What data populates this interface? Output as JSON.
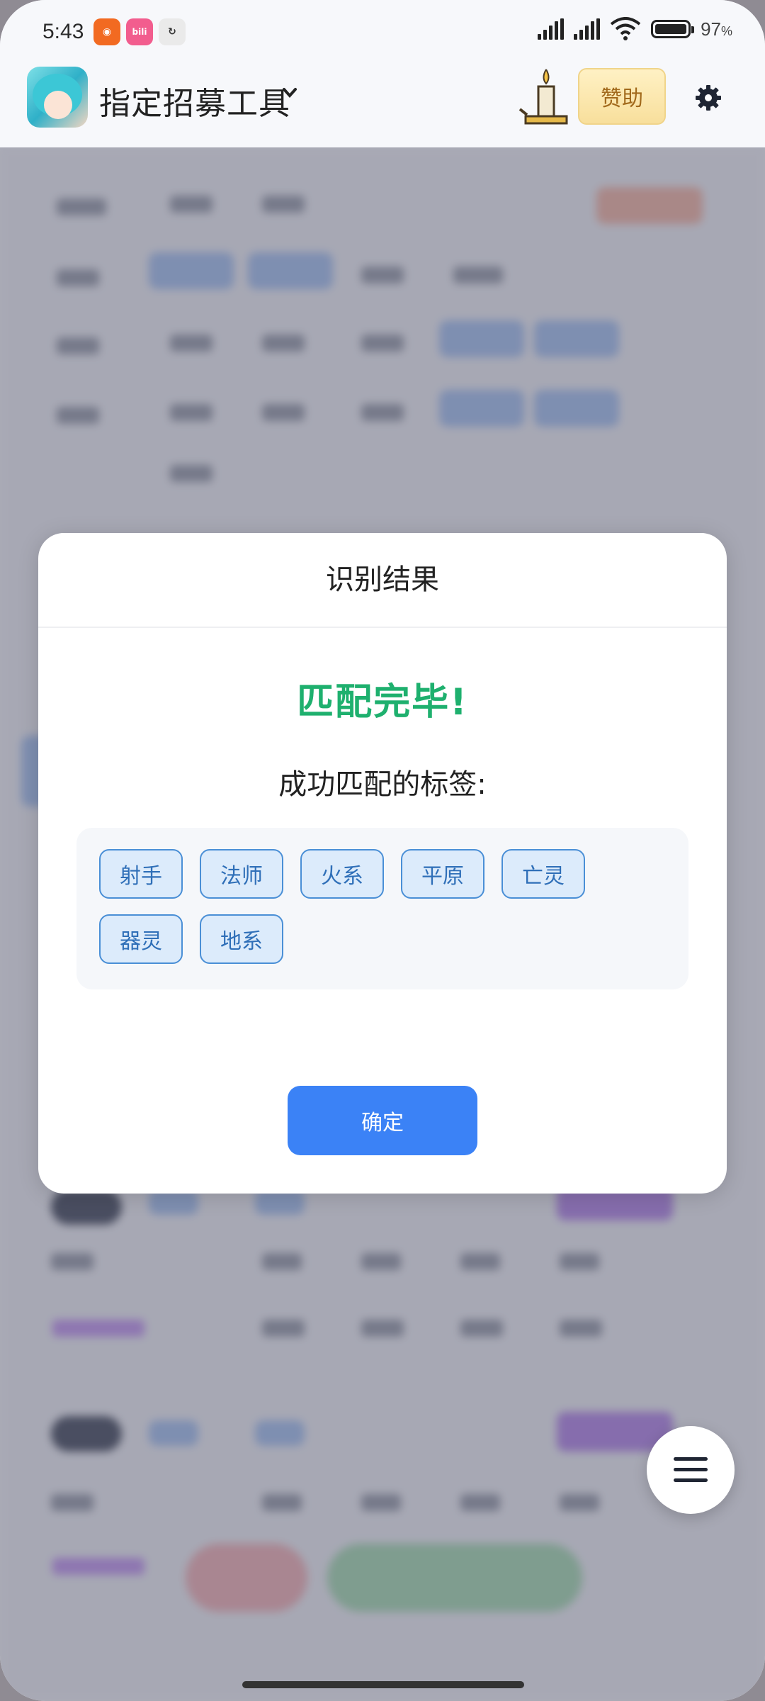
{
  "status_bar": {
    "time": "5:43",
    "battery_percent": "97",
    "battery_unit": "%",
    "notification_icons": [
      "video-call-icon",
      "bilibili-icon",
      "link-app-icon"
    ],
    "signal_icons": [
      "hd-signal-icon",
      "hd-signal-icon",
      "wifi-icon",
      "battery-icon"
    ]
  },
  "header": {
    "title": "指定招募工具",
    "sponsor_label": "赞助",
    "icons": [
      "app-avatar-icon",
      "chevron-down-icon",
      "candle-icon",
      "gear-icon"
    ]
  },
  "dialog": {
    "title": "识别结果",
    "status": "匹配完毕!",
    "subtitle": "成功匹配的标签:",
    "tags": [
      "射手",
      "法师",
      "火系",
      "平原",
      "亡灵",
      "器灵",
      "地系"
    ],
    "confirm_label": "确定"
  },
  "fab": {
    "icon": "menu-icon"
  },
  "colors": {
    "success": "#1eb06e",
    "primary": "#3b82f6",
    "tag_border": "#4a8fd6",
    "tag_bg": "#dcebfb",
    "sponsor_bg": "#f8df9c"
  }
}
